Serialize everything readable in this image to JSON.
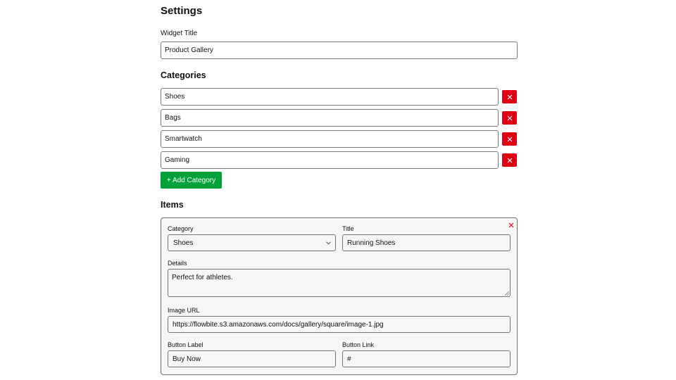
{
  "settings": {
    "title": "Settings"
  },
  "widget": {
    "label": "Widget Title",
    "value": "Product Gallery"
  },
  "categories": {
    "title": "Categories",
    "items": [
      "Shoes",
      "Bags",
      "Smartwatch",
      "Gaming"
    ],
    "add_label": "+ Add Category",
    "remove_icon": "close-icon",
    "remove_color": "#e00012",
    "add_color": "#03a13a"
  },
  "items": {
    "title": "Items",
    "card": {
      "close_icon": "close-icon",
      "category_label": "Category",
      "category_value": "Shoes",
      "title_label": "Title",
      "title_value": "Running Shoes",
      "details_label": "Details",
      "details_value": "Perfect for athletes.",
      "image_label": "Image URL",
      "image_value": "https://flowbite.s3.amazonaws.com/docs/gallery/square/image-1.jpg",
      "button_label_label": "Button Label",
      "button_label_value": "Buy Now",
      "button_link_label": "Button Link",
      "button_link_value": "#"
    }
  }
}
